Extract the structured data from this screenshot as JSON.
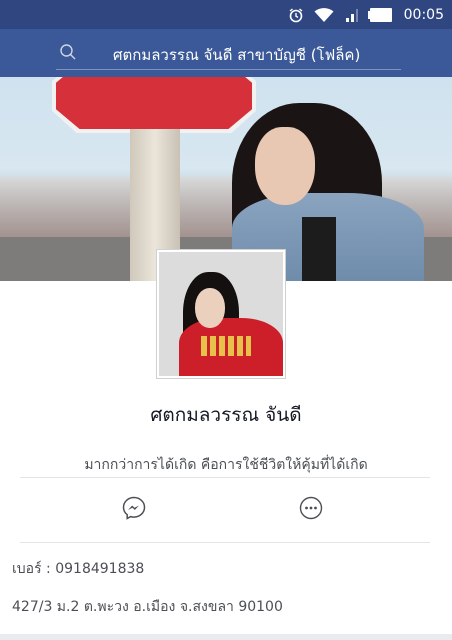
{
  "status_bar": {
    "time": "00:05",
    "icons": [
      "alarm-icon",
      "wifi-icon",
      "signal-icon",
      "battery-icon"
    ]
  },
  "header": {
    "search_text": "ศตกมลวรรณ จันดี  สาขาบัญชี  (โฟล็ค)"
  },
  "profile": {
    "name": "ศตกมลวรรณ จันดี",
    "bio": "มากกว่าการได้เกิด คือการใช้ชีวิตให้คุ้มที่ได้เกิด"
  },
  "actions": [
    "messenger-icon",
    "more-icon"
  ],
  "info": {
    "phone": "เบอร์ : 0918491838",
    "address": "427/3 ม.2 ต.พะวง อ.เมือง จ.สงขลา 90100"
  },
  "colors": {
    "status_bar": "#2f4680",
    "header": "#3b5998",
    "text_primary": "#141823",
    "text_secondary": "#4b4f56"
  }
}
